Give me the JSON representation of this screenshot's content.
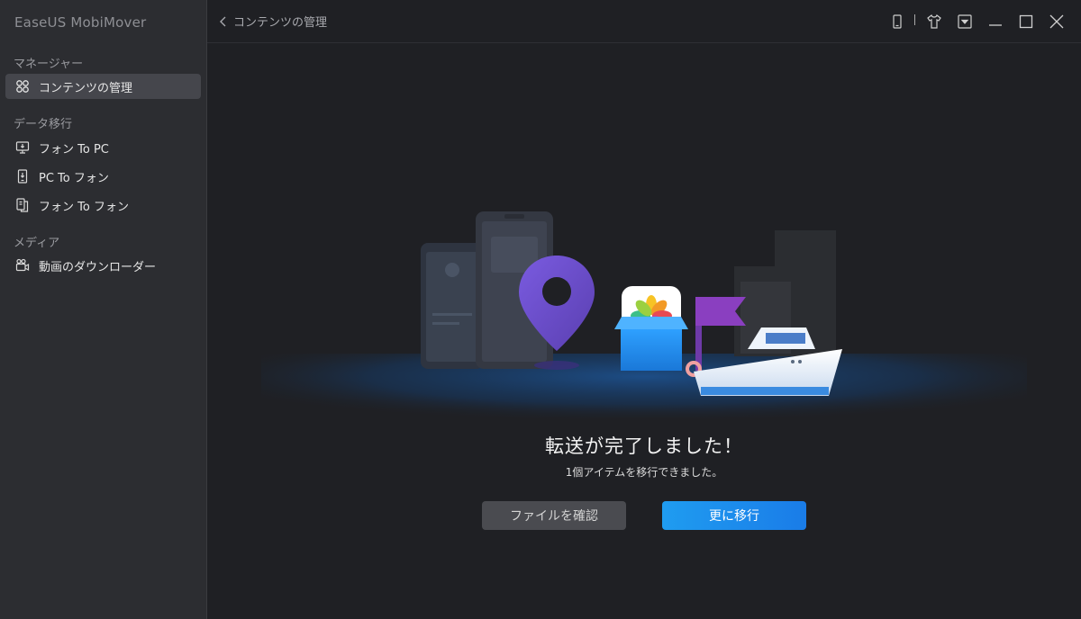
{
  "app": {
    "title": "EaseUS MobiMover"
  },
  "sidebar": {
    "sections": [
      {
        "label": "マネージャー"
      },
      {
        "label": "データ移行"
      },
      {
        "label": "メディア"
      }
    ],
    "items": [
      {
        "label": "コンテンツの管理",
        "icon": "grid-icon",
        "active": true
      },
      {
        "label": "フォン To PC",
        "icon": "phone-to-pc-icon"
      },
      {
        "label": "PC To フォン",
        "icon": "pc-to-phone-icon"
      },
      {
        "label": "フォン To フォン",
        "icon": "phone-to-phone-icon"
      },
      {
        "label": "動画のダウンローダー",
        "icon": "video-camera-icon"
      }
    ]
  },
  "topbar": {
    "back_label": "コンテンツの管理",
    "window_controls": [
      "device-icon",
      "tshirt-icon",
      "dropdown-icon",
      "minimize-icon",
      "maximize-icon",
      "close-icon"
    ]
  },
  "main": {
    "headline": "転送が完了しました！",
    "subline": "1個アイテムを移行できました。",
    "secondary_button": "ファイルを確認",
    "primary_button": "更に移行"
  },
  "colors": {
    "primary": "#1a8ff0",
    "sidebar_bg": "#2c2d31",
    "main_bg": "#1f2024",
    "pin": "#6b4fc8",
    "flag": "#8a3fc0"
  }
}
